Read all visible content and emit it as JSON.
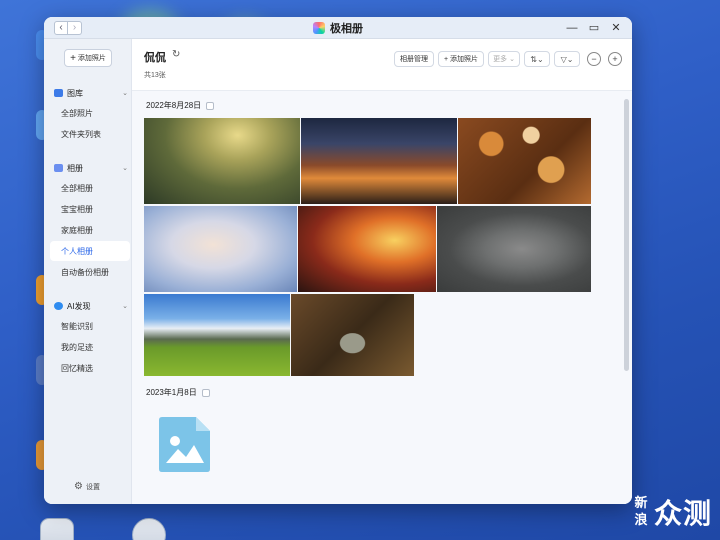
{
  "window": {
    "title": "极相册"
  },
  "sidebar": {
    "add_photo": "添加照片",
    "sections": [
      {
        "label": "图库",
        "items": [
          "全部照片",
          "文件夹列表"
        ]
      },
      {
        "label": "相册",
        "items": [
          "全部相册",
          "宝宝相册",
          "家庭相册",
          "个人相册",
          "自动备份相册"
        ]
      },
      {
        "label": "AI发现",
        "items": [
          "智能识别",
          "我的足迹",
          "回忆精选"
        ]
      }
    ],
    "active_item": "个人相册",
    "settings": "设置"
  },
  "main": {
    "album_title": "侃侃",
    "photo_count": "共13张",
    "toolbar": {
      "manage": "相册管理",
      "add_photo": "添加照片",
      "more": "更多"
    },
    "groups": [
      {
        "date": "2022年8月28日"
      },
      {
        "date": "2023年1月8日"
      }
    ]
  },
  "watermark": {
    "square_text": "新浪",
    "text": "众测"
  },
  "icons": {
    "refresh": "refresh-icon",
    "settings": "gear-icon",
    "filter": "filter-icon",
    "zoom_in": "zoom-in-icon",
    "zoom_out": "zoom-out-icon",
    "sort": "sort-icon"
  },
  "colors": {
    "accent": "#2a66e8",
    "sidebar_bg": "#edf1f7",
    "titlebar_bg": "#e6edf7"
  }
}
